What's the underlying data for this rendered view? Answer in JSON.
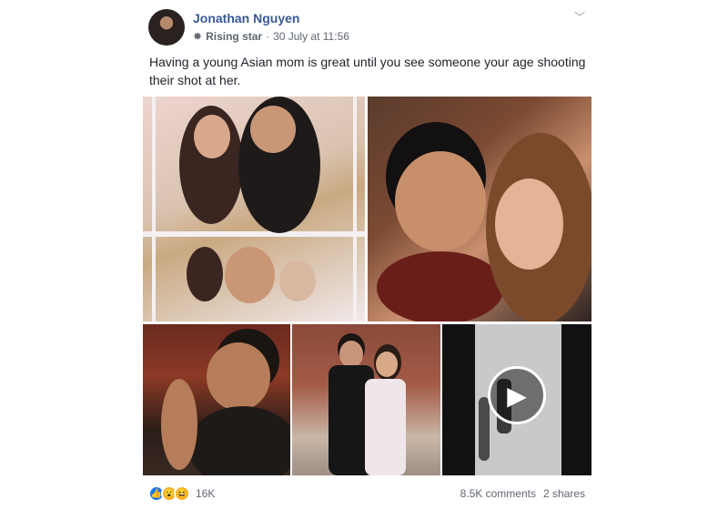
{
  "post": {
    "author": "Jonathan Nguyen",
    "badge_icon": "rising-star-icon",
    "badge": "Rising star",
    "separator": "·",
    "timestamp": "30 July at 11:56",
    "caption": "Having a young Asian mom is great until you see someone your age shooting their shot at her."
  },
  "reactions": {
    "icons": [
      "like-icon",
      "wow-icon",
      "haha-icon"
    ],
    "count": "16K",
    "comments": "8.5K comments",
    "shares": "2 shares"
  },
  "colors": {
    "author_link": "#385898",
    "meta_text": "#606770",
    "like_blue": "#1877f2",
    "reaction_yellow": "#f7b125"
  }
}
